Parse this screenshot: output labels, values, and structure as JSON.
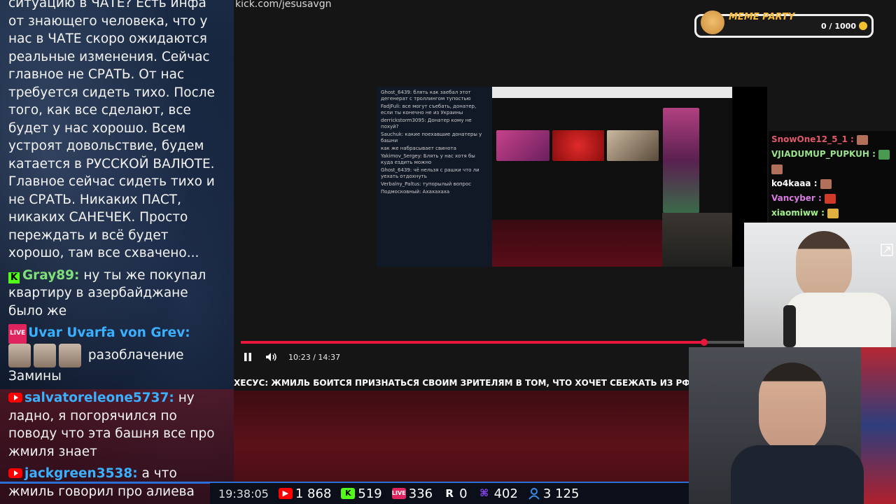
{
  "chat": {
    "intro": "ситуацию в ЧАТЕ? Есть инфа от знающего человека, что у нас в ЧАТЕ скоро ожидаются реальные изменения. Сейчас главное не СРАТЬ. От нас требуется сидеть тихо. После того, как все сделают, все будет у нас хорошо. Всем устроят довольствие, будем катается в РУССКОЙ ВАЛЮТЕ. Главное сейчас сидеть тихо и не СРАТЬ. Никаких ПАСТ, никаких САНЕЧЕК. Просто переждать и всё будет хорошо, там все схвачено...",
    "messages": [
      {
        "user": "Gray89:",
        "text": "ну ты же покупал квартиру в азербайджане было же",
        "user_color": "#7fe07a"
      },
      {
        "user": "Uvar Uvarfa von Grev:",
        "text": "разоблачение Замины",
        "user_color": "#3ab0ff"
      },
      {
        "user": "salvatoreleone5737:",
        "text": "ну ладно, я погорячился по поводу что эта башня все про жмиля знает",
        "user_color": "#3ab0ff"
      },
      {
        "user": "jackgreen3538:",
        "text": "а что жмиль говорил про алиева",
        "user_color": "#3ab0ff"
      }
    ]
  },
  "header": {
    "url": "kick.com/jesusavgn"
  },
  "meme_party": {
    "title": "MEME PARTY",
    "count": "0 / 1000"
  },
  "player": {
    "time": "10:23 / 14:37",
    "progress": 0.92
  },
  "ticker": "ХЕСУС: ЖМИЛЬ БОИТСЯ ПРИЗНАТЬСЯ СВОИМ ЗРИТЕЛЯМ В ТОМ, ЧТО ХОЧЕТ СБЕЖАТЬ ИЗ РФ",
  "side_chat": [
    {
      "user": "SnowOne12_5_1 :",
      "color": "#e05a6a"
    },
    {
      "user": "VJIADUMUP_PUPKUH :",
      "color": "#9be28e"
    },
    {
      "user": "ko4kaaa :",
      "color": "#ffffff"
    },
    {
      "user": "Vancyber :",
      "color": "#d97ae0"
    },
    {
      "user": "xiaomiww :",
      "color": "#a2f28a"
    }
  ],
  "stats": {
    "clock": "19:38:05",
    "youtube": "1 868",
    "kick": "519",
    "vk": "336",
    "rumble": "0",
    "twitch": "402",
    "viewers": "3 125"
  },
  "video_chat": {
    "lines": [
      "Ghost_6439: блять как заебал этот дегенерат с троллингом тупостью",
      "FadjFuli: все могут съебать, донатер, если ты конечно не из Украины",
      "derrickstorm3095: Донатер кому не похуй?",
      "Sauchuk: какие поехавшие донатеры у башни",
      "как же набрасывает свинота",
      "Yakimov_Sergey: Блять у нас хотя бы куда ездить можно",
      "Ghost_6439: чё нельзя с рашки что ли уехать отдохнуть",
      "Verbalny_Paltus: тупорылый вопрос",
      "Подмосковный: Ахахахаха"
    ]
  }
}
